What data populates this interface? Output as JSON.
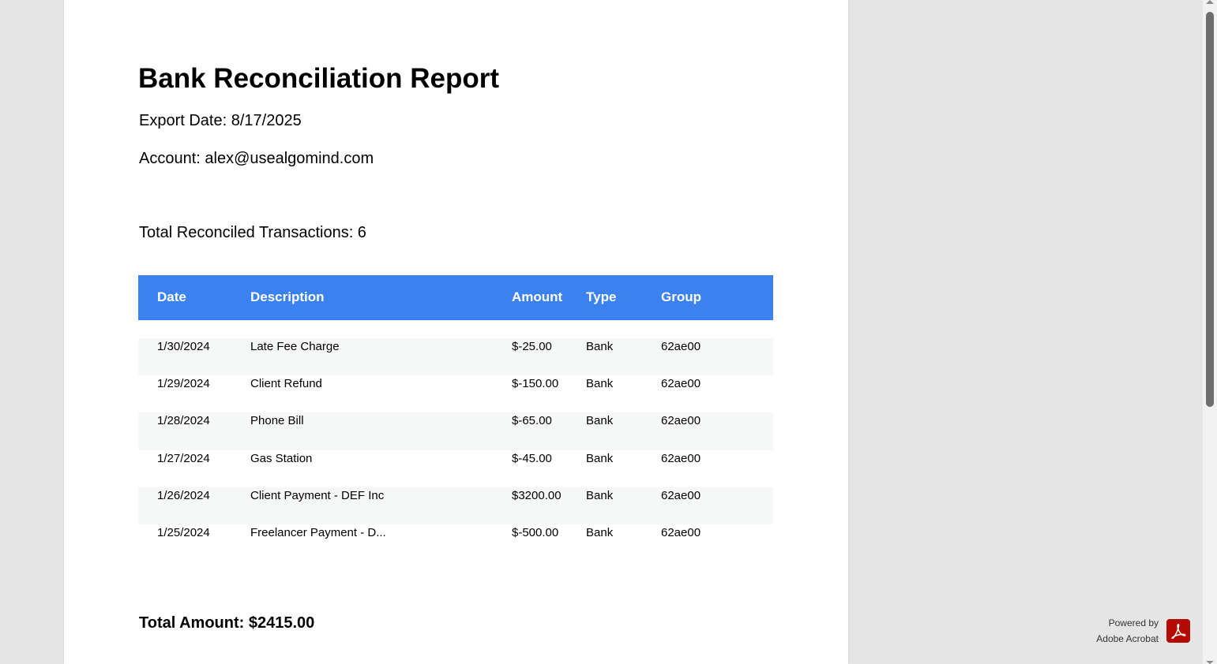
{
  "report": {
    "title": "Bank Reconciliation Report",
    "export_date": "Export Date: 8/17/2025",
    "account": "Account: alex@usealgomind.com",
    "total_transactions": "Total Reconciled Transactions: 6",
    "total_amount": "Total Amount: $2415.00"
  },
  "table": {
    "headers": [
      "Date",
      "Description",
      "Amount",
      "Type",
      "Group"
    ],
    "rows": [
      [
        "1/30/2024",
        "Late Fee Charge",
        "$-25.00",
        "Bank",
        "62ae00"
      ],
      [
        "1/29/2024",
        "Client Refund",
        "$-150.00",
        "Bank",
        "62ae00"
      ],
      [
        "1/28/2024",
        "Phone Bill",
        "$-65.00",
        "Bank",
        "62ae00"
      ],
      [
        "1/27/2024",
        "Gas Station",
        "$-45.00",
        "Bank",
        "62ae00"
      ],
      [
        "1/26/2024",
        "Client Payment - DEF Inc",
        "$3200.00",
        "Bank",
        "62ae00"
      ],
      [
        "1/25/2024",
        "Freelancer Payment - D...",
        "$-500.00",
        "Bank",
        "62ae00"
      ]
    ]
  },
  "branding": {
    "powered_by": "Powered by",
    "product": "Adobe Acrobat",
    "logo_icon": "adobe-acrobat-icon"
  },
  "colors": {
    "header_bg": "#3b82f0",
    "row_alt_bg": "#f6f7f7",
    "acrobat_red": "#b30b00"
  }
}
